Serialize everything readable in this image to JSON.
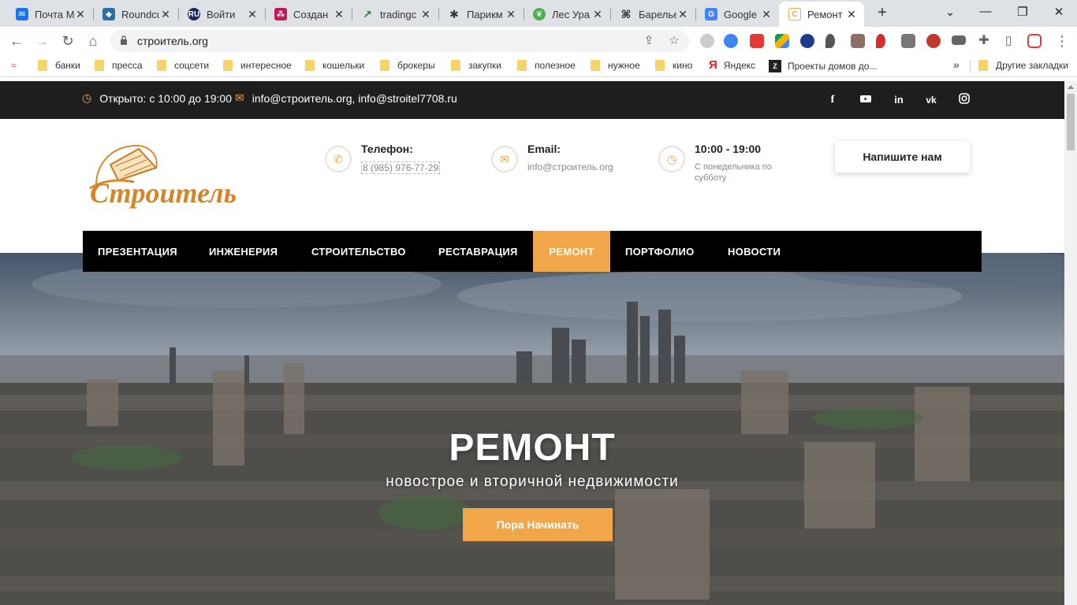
{
  "browser": {
    "tabs": [
      {
        "title": "Почта М",
        "icon": "mail-icon",
        "color": "#1a73e8"
      },
      {
        "title": "Roundcu",
        "icon": "roundcube-icon",
        "color": "#2a6fa8"
      },
      {
        "title": "Войти",
        "icon": "ru-icon",
        "color": "#1a2a5a"
      },
      {
        "title": "Создан",
        "icon": "grid-icon",
        "color": "#c2185b"
      },
      {
        "title": "tradingc",
        "icon": "chart-icon",
        "color": "#2e7d32"
      },
      {
        "title": "Парикм",
        "icon": "spider-icon",
        "color": "#333333"
      },
      {
        "title": "Лес Ура",
        "icon": "leaf-icon",
        "color": "#4caf50"
      },
      {
        "title": "Барелье",
        "icon": "knot-icon",
        "color": "#222222"
      },
      {
        "title": "Google",
        "icon": "google-translate-icon",
        "color": "#4285f4"
      },
      {
        "title": "Ремонт",
        "icon": "site-icon",
        "color": "#f2a64a",
        "active": true
      }
    ],
    "url": "строитель.org",
    "bookmarks": [
      "банки",
      "пресса",
      "соцсети",
      "интересное",
      "кошельки",
      "брокеры",
      "закупки",
      "полезное",
      "нужное",
      "кино",
      "Яндекс",
      "Проекты домов до...",
      "Другие закладки"
    ],
    "more_symbol": "»"
  },
  "topstrip": {
    "hours": "Открыто: с 10:00 до 19:00",
    "emails": "info@строитель.org, info@stroitel7708.ru",
    "social": [
      "facebook-icon",
      "youtube-icon",
      "linkedin-icon",
      "vk-icon",
      "instagram-icon"
    ]
  },
  "header": {
    "logo_text": "Строитель",
    "phone_title": "Телефон:",
    "phone_value": "8 (985) 976-77-29",
    "email_title": "Email:",
    "email_value": "info@строитель.org",
    "hours_title": "10:00 - 19:00",
    "hours_sub": "С понедельника по субботу",
    "cta": "Напишите нам"
  },
  "nav": {
    "items": [
      "ПРЕЗЕНТАЦИЯ",
      "ИНЖЕНЕРИЯ",
      "СТРОИТЕЛЬСТВО",
      "РЕСТАВРАЦИЯ",
      "РЕМОНТ",
      "ПОРТФОЛИО",
      "НОВОСТИ"
    ],
    "active": "РЕМОНТ"
  },
  "hero": {
    "title": "РЕМОНТ",
    "subtitle": "новострое и вторичной недвижимости",
    "button": "Пора Начинать"
  },
  "colors": {
    "accent": "#f2a64a",
    "dark": "#1e1e1e",
    "nav_bg": "#000000"
  }
}
